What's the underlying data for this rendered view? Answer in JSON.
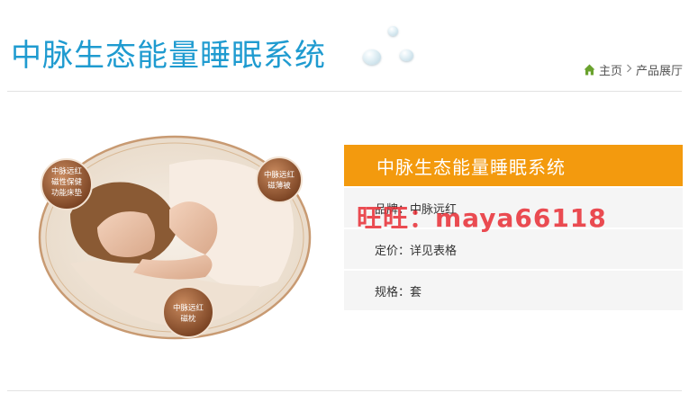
{
  "header": {
    "page_title": "中脉生态能量睡眠系统"
  },
  "breadcrumb": {
    "home": "主页",
    "separator": ">",
    "current": "产品展厅",
    "home_icon": "home-icon"
  },
  "product": {
    "image_badges": [
      "中脉远红\n磁性保健\n功能床垫",
      "中脉远红\n磁薄被",
      "中脉远红\n磁枕"
    ]
  },
  "info": {
    "title": "中脉生态能量睡眠系统",
    "brand": "品牌：中脉远红",
    "price": "定价：详见表格",
    "spec": "规格：套"
  },
  "watermark": "旺旺：maya66118",
  "colors": {
    "title_blue": "#1f9bd0",
    "header_orange": "#f39a0e",
    "watermark_red": "#e8262e",
    "home_icon_green": "#6aa22e"
  }
}
